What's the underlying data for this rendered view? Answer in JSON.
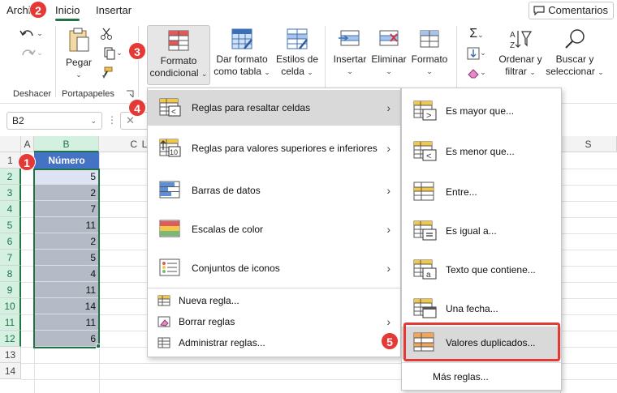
{
  "tabs": {
    "archivo": "Archivo",
    "inicio": "Inicio",
    "insertar": "Insertar",
    "comentarios": "Comentarios"
  },
  "ribbon": {
    "deshacer_group": "Deshacer",
    "portapapeles_group": "Portapapeles",
    "pegar": "Pegar",
    "formato_condicional_1": "Formato",
    "formato_condicional_2": "condicional",
    "dar_formato_1": "Dar formato",
    "dar_formato_2": "como tabla",
    "estilos_1": "Estilos de",
    "estilos_2": "celda",
    "insertar": "Insertar",
    "eliminar": "Eliminar",
    "formato": "Formato",
    "ordenar_1": "Ordenar y",
    "ordenar_2": "filtrar",
    "buscar_1": "Buscar y",
    "buscar_2": "seleccionar"
  },
  "formula_bar": {
    "name_box": "B2"
  },
  "grid": {
    "columns": [
      "A",
      "B",
      "C",
      "L",
      "S"
    ],
    "rows": [
      "1",
      "2",
      "3",
      "4",
      "5",
      "6",
      "7",
      "8",
      "9",
      "10",
      "11",
      "12",
      "13",
      "14"
    ],
    "header": "Número",
    "values": [
      "5",
      "2",
      "7",
      "11",
      "2",
      "5",
      "4",
      "11",
      "14",
      "11",
      "6"
    ]
  },
  "cf_menu": {
    "items": [
      "Reglas para resaltar celdas",
      "Reglas para valores superiores e inferiores",
      "Barras de datos",
      "Escalas de color",
      "Conjuntos de iconos"
    ],
    "small_items": [
      "Nueva regla...",
      "Borrar reglas",
      "Administrar reglas..."
    ]
  },
  "submenu": {
    "items": [
      "Es mayor que...",
      "Es menor que...",
      "Entre...",
      "Es igual a...",
      "Texto que contiene...",
      "Una fecha...",
      "Valores duplicados..."
    ],
    "more": "Más reglas..."
  },
  "badges": [
    "1",
    "2",
    "3",
    "4",
    "5"
  ],
  "colors": {
    "accent": "#217346",
    "header_fill": "#4472c4",
    "badge": "#e53935"
  }
}
